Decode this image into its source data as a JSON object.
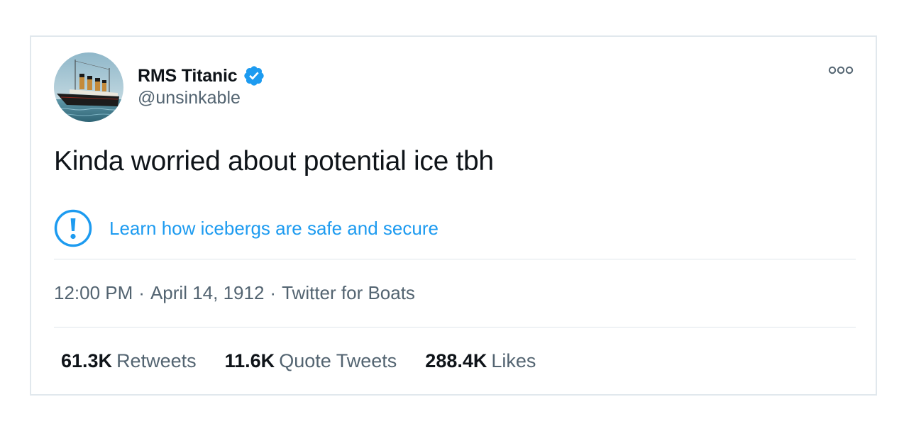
{
  "author": {
    "display_name": "RMS Titanic",
    "handle": "@unsinkable",
    "verified": true
  },
  "icons": {
    "avatar": "titanic-ship-avatar",
    "verified": "verified-badge-icon",
    "more": "more-options-icon",
    "notice": "exclamation-circle-icon"
  },
  "tweet": {
    "text": "Kinda worried about potential ice tbh"
  },
  "notice": {
    "link_text": "Learn how icebergs are safe and secure"
  },
  "meta": {
    "time": "12:00 PM",
    "separator": "·",
    "date": "April 14, 1912",
    "source": "Twitter for Boats"
  },
  "stats": [
    {
      "count": "61.3K",
      "label": "Retweets"
    },
    {
      "count": "11.6K",
      "label": "Quote Tweets"
    },
    {
      "count": "288.4K",
      "label": "Likes"
    }
  ],
  "colors": {
    "accent": "#1d9bf0",
    "text_primary": "#0f1419",
    "text_secondary": "#536471",
    "border": "#e1e8ed"
  }
}
